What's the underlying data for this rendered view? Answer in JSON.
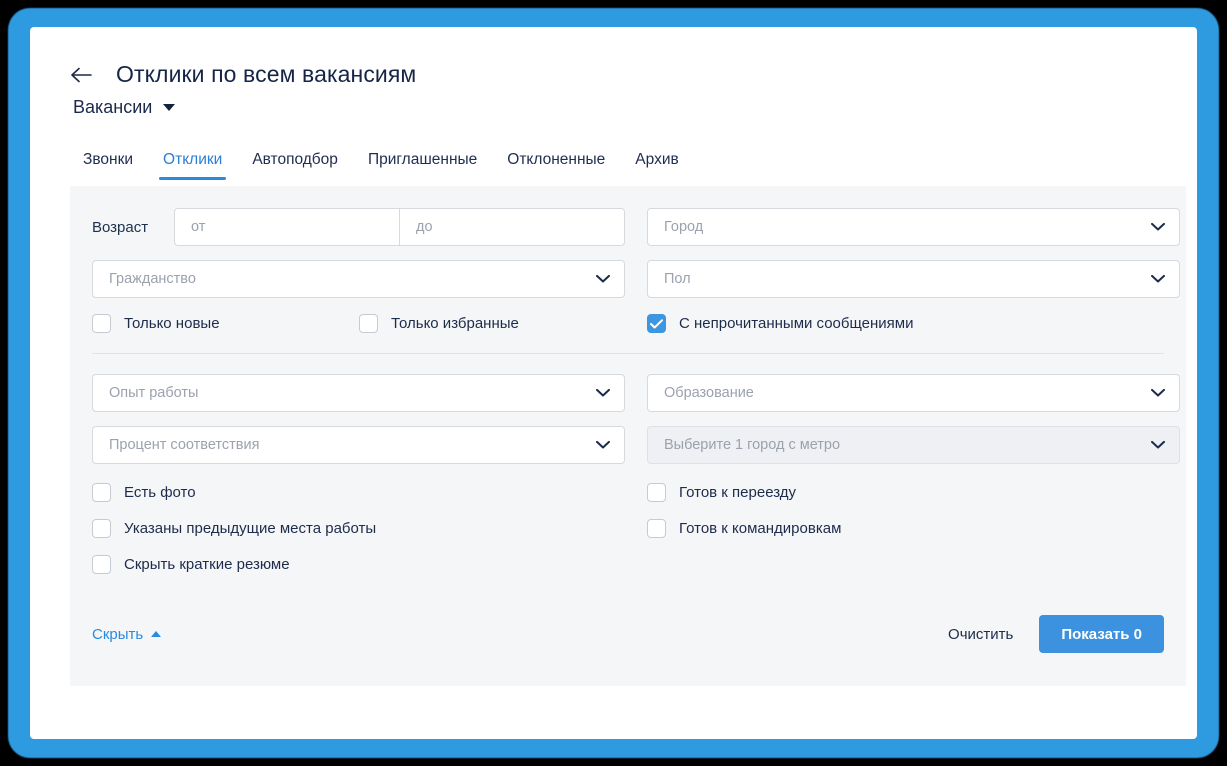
{
  "header": {
    "back_icon": "arrow-left-icon",
    "title": "Отклики по всем вакансиям",
    "breadcrumb": "Вакансии",
    "breadcrumb_caret": "chevron-down-icon"
  },
  "tabs": [
    {
      "label": "Звонки",
      "active": false
    },
    {
      "label": "Отклики",
      "active": true
    },
    {
      "label": "Автоподбор",
      "active": false
    },
    {
      "label": "Приглашенные",
      "active": false
    },
    {
      "label": "Отклоненные",
      "active": false
    },
    {
      "label": "Архив",
      "active": false
    }
  ],
  "filters": {
    "age": {
      "label": "Возраст",
      "from_placeholder": "от",
      "from_value": "",
      "to_placeholder": "до",
      "to_value": ""
    },
    "city": {
      "placeholder": "Город",
      "value": "",
      "disabled": false
    },
    "citizenship": {
      "placeholder": "Гражданство",
      "value": "",
      "disabled": false
    },
    "gender": {
      "placeholder": "Пол",
      "value": "",
      "disabled": false
    },
    "experience": {
      "placeholder": "Опыт работы",
      "value": "",
      "disabled": false
    },
    "education": {
      "placeholder": "Образование",
      "value": "",
      "disabled": false
    },
    "match_percent": {
      "placeholder": "Процент соответствия",
      "value": "",
      "disabled": false
    },
    "metro_city": {
      "placeholder": "Выберите 1 город с метро",
      "value": "",
      "disabled": true
    },
    "checkboxes_top": [
      {
        "label": "Только новые",
        "checked": false
      },
      {
        "label": "Только избранные",
        "checked": false
      },
      {
        "label": "С непрочитанными сообщениями",
        "checked": true
      }
    ],
    "checkboxes_left": [
      {
        "label": "Есть фото",
        "checked": false
      },
      {
        "label": "Указаны предыдущие места работы",
        "checked": false
      },
      {
        "label": "Скрыть краткие резюме",
        "checked": false
      }
    ],
    "checkboxes_right": [
      {
        "label": "Готов к переезду",
        "checked": false
      },
      {
        "label": "Готов к командировкам",
        "checked": false
      }
    ]
  },
  "actions": {
    "hide_label": "Скрыть",
    "hide_caret": "caret-up-icon",
    "clear_label": "Очистить",
    "show_label": "Показать 0"
  },
  "colors": {
    "accent": "#3c92de",
    "tab_active": "#2a8ae0",
    "text": "#1e2c4b",
    "placeholder": "#9ba2ae",
    "panel_bg": "#f5f6f7",
    "frame": "#2e9ae0"
  }
}
